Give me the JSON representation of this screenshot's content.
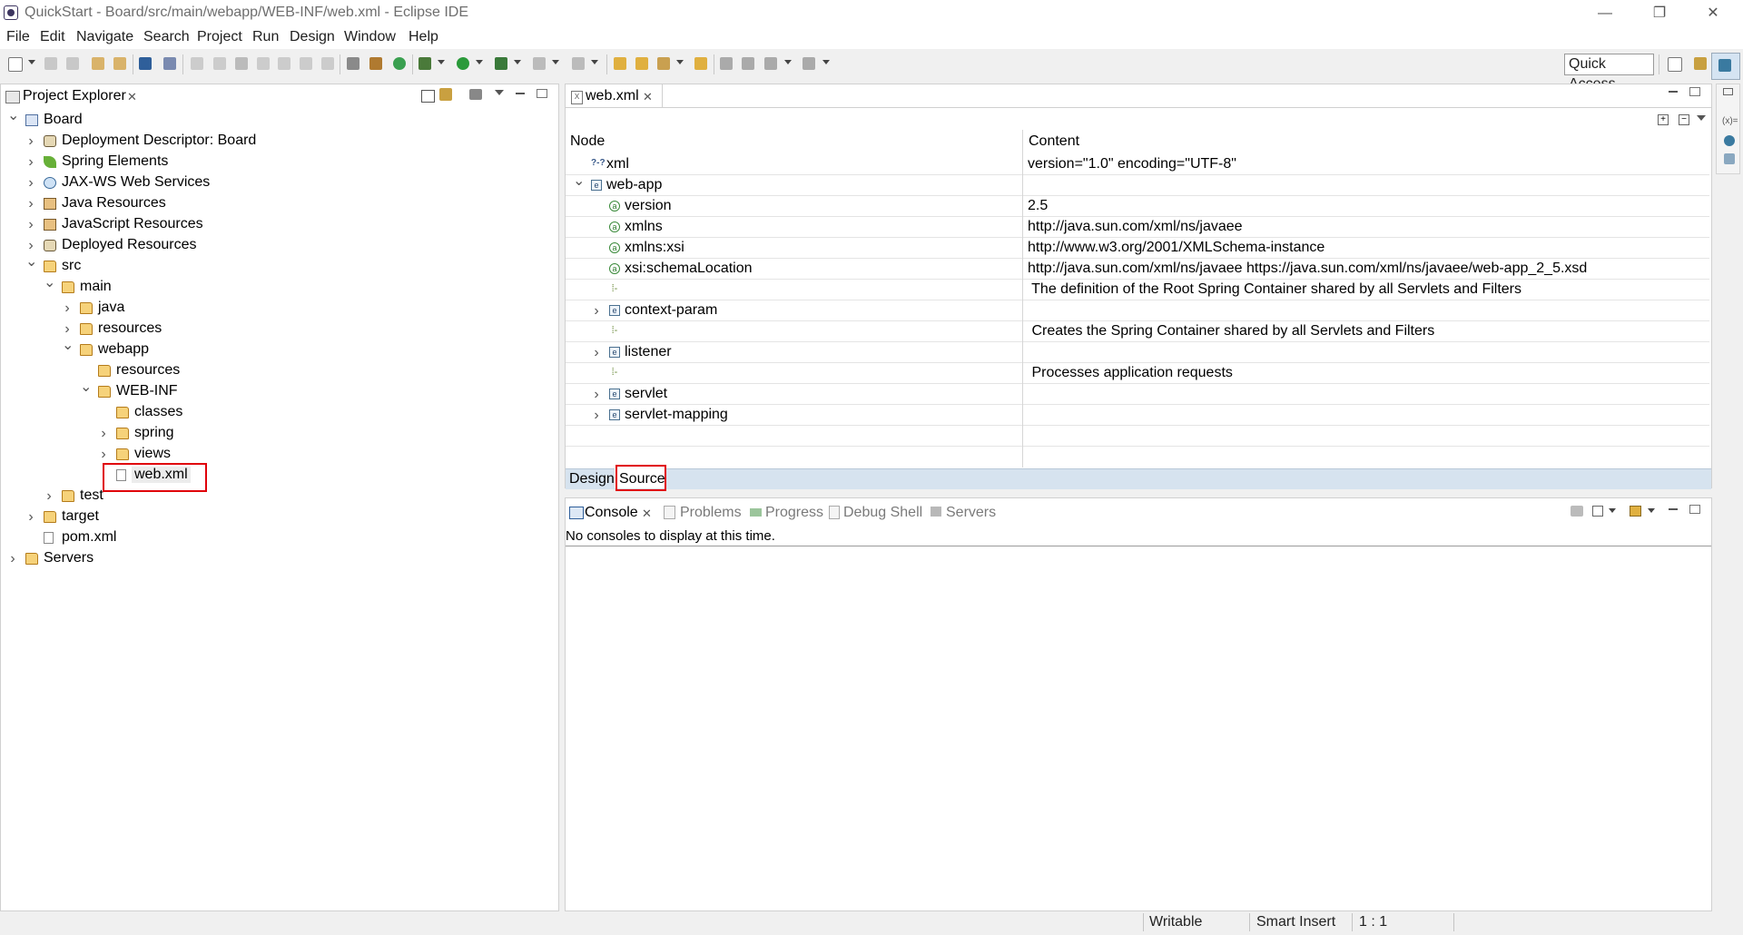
{
  "window": {
    "title": "QuickStart - Board/src/main/webapp/WEB-INF/web.xml - Eclipse IDE",
    "minimize": "—",
    "restore": "❐",
    "close": "✕"
  },
  "menu": [
    "File",
    "Edit",
    "Navigate",
    "Search",
    "Project",
    "Run",
    "Design",
    "Window",
    "Help"
  ],
  "toolbar": {
    "quick_access": "Quick Access"
  },
  "project_explorer": {
    "title": "Project Explorer",
    "tree": [
      {
        "label": "Board",
        "depth": 0,
        "twisty": "v",
        "icon": "project-icon"
      },
      {
        "label": "Deployment Descriptor: Board",
        "depth": 1,
        "twisty": ">",
        "icon": "deployment-descriptor-icon"
      },
      {
        "label": "Spring Elements",
        "depth": 1,
        "twisty": ">",
        "icon": "spring-leaf-icon"
      },
      {
        "label": "JAX-WS Web Services",
        "depth": 1,
        "twisty": ">",
        "icon": "web-services-icon"
      },
      {
        "label": "Java Resources",
        "depth": 1,
        "twisty": ">",
        "icon": "java-resources-icon"
      },
      {
        "label": "JavaScript Resources",
        "depth": 1,
        "twisty": ">",
        "icon": "javascript-resources-icon"
      },
      {
        "label": "Deployed Resources",
        "depth": 1,
        "twisty": ">",
        "icon": "deployed-resources-icon"
      },
      {
        "label": "src",
        "depth": 1,
        "twisty": "v",
        "icon": "folder-icon"
      },
      {
        "label": "main",
        "depth": 2,
        "twisty": "v",
        "icon": "folder-icon"
      },
      {
        "label": "java",
        "depth": 3,
        "twisty": ">",
        "icon": "folder-icon"
      },
      {
        "label": "resources",
        "depth": 3,
        "twisty": ">",
        "icon": "folder-icon"
      },
      {
        "label": "webapp",
        "depth": 3,
        "twisty": "v",
        "icon": "folder-icon"
      },
      {
        "label": "resources",
        "depth": 4,
        "twisty": "",
        "icon": "folder-icon"
      },
      {
        "label": "WEB-INF",
        "depth": 4,
        "twisty": "v",
        "icon": "folder-icon"
      },
      {
        "label": "classes",
        "depth": 5,
        "twisty": "",
        "icon": "folder-icon"
      },
      {
        "label": "spring",
        "depth": 5,
        "twisty": ">",
        "icon": "folder-icon"
      },
      {
        "label": "views",
        "depth": 5,
        "twisty": ">",
        "icon": "folder-icon"
      },
      {
        "label": "web.xml",
        "depth": 5,
        "twisty": "",
        "icon": "xml-file-icon",
        "selected": true
      },
      {
        "label": "test",
        "depth": 2,
        "twisty": ">",
        "icon": "folder-icon"
      },
      {
        "label": "target",
        "depth": 1,
        "twisty": ">",
        "icon": "folder-icon"
      },
      {
        "label": "pom.xml",
        "depth": 1,
        "twisty": "",
        "icon": "pom-file-icon"
      },
      {
        "label": "Servers",
        "depth": 0,
        "twisty": ">",
        "icon": "folder-icon"
      }
    ]
  },
  "editor": {
    "tab": "web.xml",
    "headers": {
      "node": "Node",
      "content": "Content"
    },
    "rows": [
      {
        "node": "xml",
        "content": "version=\"1.0\" encoding=\"UTF-8\"",
        "indent": 0,
        "twisty": "",
        "icon": "processing-instruction-icon"
      },
      {
        "node": "web-app",
        "content": "",
        "indent": 0,
        "twisty": "v",
        "icon": "element-icon"
      },
      {
        "node": "version",
        "content": "2.5",
        "indent": 1,
        "twisty": "",
        "icon": "attribute-icon"
      },
      {
        "node": "xmlns",
        "content": "http://java.sun.com/xml/ns/javaee",
        "indent": 1,
        "twisty": "",
        "icon": "attribute-icon"
      },
      {
        "node": "xmlns:xsi",
        "content": "http://www.w3.org/2001/XMLSchema-instance",
        "indent": 1,
        "twisty": "",
        "icon": "attribute-icon"
      },
      {
        "node": "xsi:schemaLocation",
        "content": "http://java.sun.com/xml/ns/javaee https://java.sun.com/xml/ns/javaee/web-app_2_5.xsd",
        "indent": 1,
        "twisty": "",
        "icon": "attribute-icon"
      },
      {
        "node": "",
        "content": " The definition of the Root Spring Container shared by all Servlets and Filters",
        "indent": 1,
        "twisty": "",
        "icon": "comment-icon"
      },
      {
        "node": "context-param",
        "content": "",
        "indent": 1,
        "twisty": ">",
        "icon": "element-icon"
      },
      {
        "node": "",
        "content": " Creates the Spring Container shared by all Servlets and Filters",
        "indent": 1,
        "twisty": "",
        "icon": "comment-icon"
      },
      {
        "node": "listener",
        "content": "",
        "indent": 1,
        "twisty": ">",
        "icon": "element-icon"
      },
      {
        "node": "",
        "content": " Processes application requests",
        "indent": 1,
        "twisty": "",
        "icon": "comment-icon"
      },
      {
        "node": "servlet",
        "content": "",
        "indent": 1,
        "twisty": ">",
        "icon": "element-icon"
      },
      {
        "node": "servlet-mapping",
        "content": "",
        "indent": 1,
        "twisty": ">",
        "icon": "element-icon"
      },
      {
        "node": "",
        "content": "",
        "indent": 0,
        "twisty": "",
        "icon": ""
      }
    ],
    "bottom_tabs": {
      "design": "Design",
      "source": "Source"
    }
  },
  "console": {
    "tabs": [
      "Console",
      "Problems",
      "Progress",
      "Debug Shell",
      "Servers"
    ],
    "message": "No consoles to display at this time."
  },
  "statusbar": {
    "writable": "Writable",
    "insert_mode": "Smart Insert",
    "position": "1 : 1"
  },
  "colors": {
    "highlight_box": "#e0000a",
    "editor_bottom_bar": "#d6e3ef"
  }
}
